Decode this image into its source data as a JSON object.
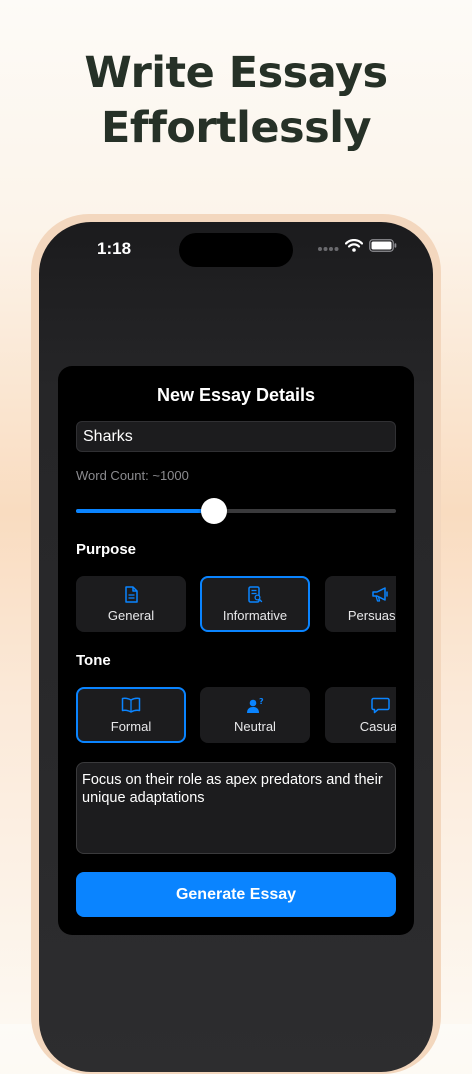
{
  "headline": {
    "line1": "Write Essays",
    "line2": "Effortlessly"
  },
  "status_bar": {
    "time": "1:18",
    "icons": [
      "signal-dots-icon",
      "wifi-icon",
      "battery-icon"
    ]
  },
  "sheet": {
    "title": "New Essay Details",
    "topic_value": "Sharks",
    "word_count_label": "Word Count: ~1000",
    "word_count_slider_fraction": 0.43,
    "purpose": {
      "label": "Purpose",
      "options": [
        {
          "label": "General",
          "icon": "document-icon",
          "selected": false
        },
        {
          "label": "Informative",
          "icon": "document-search-icon",
          "selected": true
        },
        {
          "label": "Persuasive",
          "icon": "megaphone-icon",
          "selected": false
        }
      ]
    },
    "tone": {
      "label": "Tone",
      "options": [
        {
          "label": "Formal",
          "icon": "open-book-icon",
          "selected": true
        },
        {
          "label": "Neutral",
          "icon": "person-question-icon",
          "selected": false
        },
        {
          "label": "Casual",
          "icon": "chat-bubble-icon",
          "selected": false
        }
      ]
    },
    "notes_value": "Focus on their role as apex predators and their unique adaptations",
    "generate_label": "Generate Essay"
  },
  "colors": {
    "accent": "#0a84ff",
    "headline": "#263127",
    "sheet_background": "#000000",
    "field_background": "#1c1c1e"
  }
}
